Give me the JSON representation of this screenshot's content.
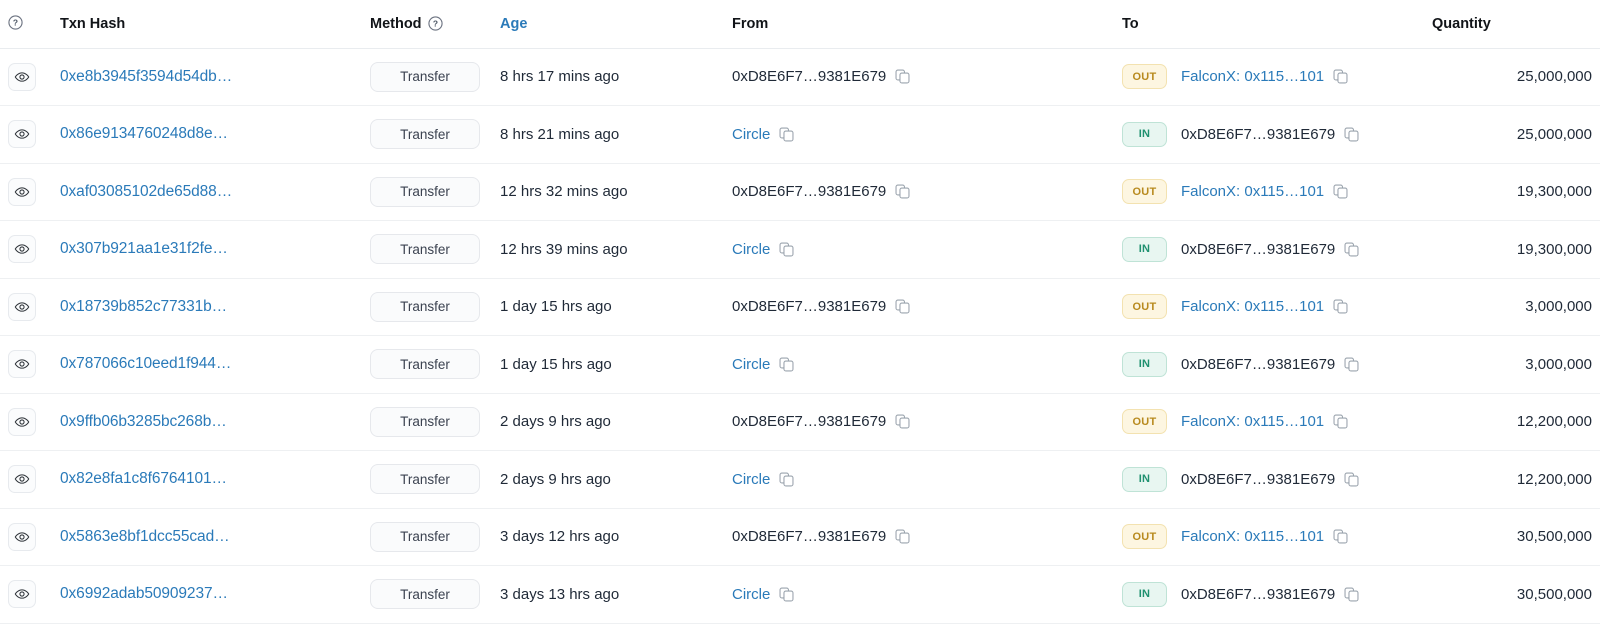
{
  "table": {
    "columns": {
      "eye": "",
      "txn_hash": "Txn Hash",
      "method": "Method",
      "age": "Age",
      "from": "From",
      "to": "To",
      "quantity": "Quantity"
    },
    "header_icons": {
      "eye_help": "question-circle-icon",
      "method_help": "question-circle-icon"
    },
    "sorted_column": "Age",
    "accent_link_color": "#2a7ab9",
    "badge_colors": {
      "out_bg": "#fdf6e1",
      "out_border": "#f3e2b0",
      "out_text": "#b88a1e",
      "in_bg": "#e8f6f1",
      "in_border": "#bfe3d6",
      "in_text": "#1f9170"
    },
    "rows": [
      {
        "eye_icon": "eye-icon",
        "hash": "0xe8b3945f3594d54db…",
        "method": "Transfer",
        "age": "8 hrs 17 mins ago",
        "from": "0xD8E6F7…9381E679",
        "from_is_link": false,
        "from_copy_icon": "copy-icon",
        "direction": "OUT",
        "to": "FalconX: 0x115…101",
        "to_is_link": true,
        "to_copy_icon": "copy-icon",
        "quantity": "25,000,000"
      },
      {
        "eye_icon": "eye-icon",
        "hash": "0x86e9134760248d8e…",
        "method": "Transfer",
        "age": "8 hrs 21 mins ago",
        "from": "Circle",
        "from_is_link": true,
        "from_copy_icon": "copy-icon",
        "direction": "IN",
        "to": "0xD8E6F7…9381E679",
        "to_is_link": false,
        "to_copy_icon": "copy-icon",
        "quantity": "25,000,000"
      },
      {
        "eye_icon": "eye-icon",
        "hash": "0xaf03085102de65d88…",
        "method": "Transfer",
        "age": "12 hrs 32 mins ago",
        "from": "0xD8E6F7…9381E679",
        "from_is_link": false,
        "from_copy_icon": "copy-icon",
        "direction": "OUT",
        "to": "FalconX: 0x115…101",
        "to_is_link": true,
        "to_copy_icon": "copy-icon",
        "quantity": "19,300,000"
      },
      {
        "eye_icon": "eye-icon",
        "hash": "0x307b921aa1e31f2fe…",
        "method": "Transfer",
        "age": "12 hrs 39 mins ago",
        "from": "Circle",
        "from_is_link": true,
        "from_copy_icon": "copy-icon",
        "direction": "IN",
        "to": "0xD8E6F7…9381E679",
        "to_is_link": false,
        "to_copy_icon": "copy-icon",
        "quantity": "19,300,000"
      },
      {
        "eye_icon": "eye-icon",
        "hash": "0x18739b852c77331b…",
        "method": "Transfer",
        "age": "1 day 15 hrs ago",
        "from": "0xD8E6F7…9381E679",
        "from_is_link": false,
        "from_copy_icon": "copy-icon",
        "direction": "OUT",
        "to": "FalconX: 0x115…101",
        "to_is_link": true,
        "to_copy_icon": "copy-icon",
        "quantity": "3,000,000"
      },
      {
        "eye_icon": "eye-icon",
        "hash": "0x787066c10eed1f944…",
        "method": "Transfer",
        "age": "1 day 15 hrs ago",
        "from": "Circle",
        "from_is_link": true,
        "from_copy_icon": "copy-icon",
        "direction": "IN",
        "to": "0xD8E6F7…9381E679",
        "to_is_link": false,
        "to_copy_icon": "copy-icon",
        "quantity": "3,000,000"
      },
      {
        "eye_icon": "eye-icon",
        "hash": "0x9ffb06b3285bc268b…",
        "method": "Transfer",
        "age": "2 days 9 hrs ago",
        "from": "0xD8E6F7…9381E679",
        "from_is_link": false,
        "from_copy_icon": "copy-icon",
        "direction": "OUT",
        "to": "FalconX: 0x115…101",
        "to_is_link": true,
        "to_copy_icon": "copy-icon",
        "quantity": "12,200,000"
      },
      {
        "eye_icon": "eye-icon",
        "hash": "0x82e8fa1c8f6764101…",
        "method": "Transfer",
        "age": "2 days 9 hrs ago",
        "from": "Circle",
        "from_is_link": true,
        "from_copy_icon": "copy-icon",
        "direction": "IN",
        "to": "0xD8E6F7…9381E679",
        "to_is_link": false,
        "to_copy_icon": "copy-icon",
        "quantity": "12,200,000"
      },
      {
        "eye_icon": "eye-icon",
        "hash": "0x5863e8bf1dcc55cad…",
        "method": "Transfer",
        "age": "3 days 12 hrs ago",
        "from": "0xD8E6F7…9381E679",
        "from_is_link": false,
        "from_copy_icon": "copy-icon",
        "direction": "OUT",
        "to": "FalconX: 0x115…101",
        "to_is_link": true,
        "to_copy_icon": "copy-icon",
        "quantity": "30,500,000"
      },
      {
        "eye_icon": "eye-icon",
        "hash": "0x6992adab50909237…",
        "method": "Transfer",
        "age": "3 days 13 hrs ago",
        "from": "Circle",
        "from_is_link": true,
        "from_copy_icon": "copy-icon",
        "direction": "IN",
        "to": "0xD8E6F7…9381E679",
        "to_is_link": false,
        "to_copy_icon": "copy-icon",
        "quantity": "30,500,000"
      }
    ]
  }
}
